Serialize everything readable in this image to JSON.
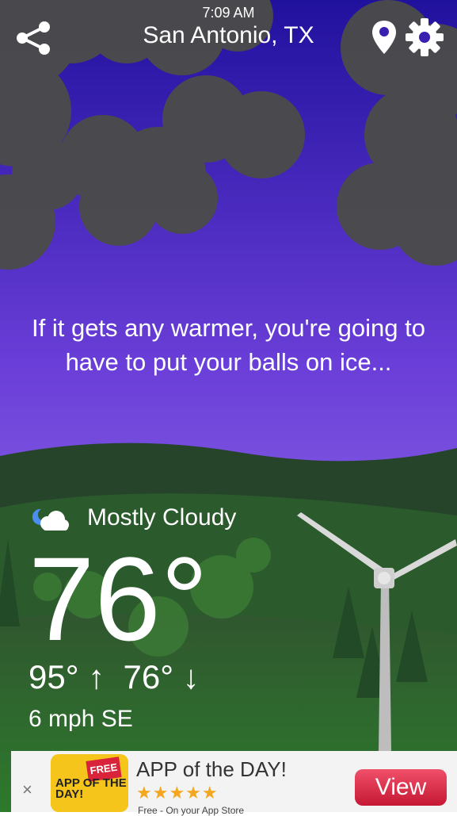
{
  "header": {
    "time": "7:09 AM",
    "city": "San Antonio, TX",
    "share_icon": "share-icon",
    "location_icon": "location-pin-icon",
    "settings_icon": "gear-icon"
  },
  "message": "If it gets any warmer, you're going to have to put your balls on ice...",
  "weather": {
    "condition_icon": "moon-cloud-icon",
    "condition": "Mostly Cloudy",
    "temperature": "76°",
    "high": "95°",
    "low": "76°",
    "up_arrow": "↑",
    "down_arrow": "↓",
    "wind": "6 mph SE"
  },
  "ad": {
    "close": "×",
    "logo_text": "APP OF THE DAY!",
    "badge": "FREE",
    "title": "APP of the DAY!",
    "stars": "★★★★★",
    "subtitle": "Free - On your App Store",
    "button": "View"
  },
  "colors": {
    "sky_top": "#2a16a6",
    "sky_bottom": "#a47ef0",
    "hill_dark": "#244a2c",
    "grass": "#2f6a2a",
    "cloud": "#4a4a4a",
    "ad_button": "#d8233a"
  }
}
